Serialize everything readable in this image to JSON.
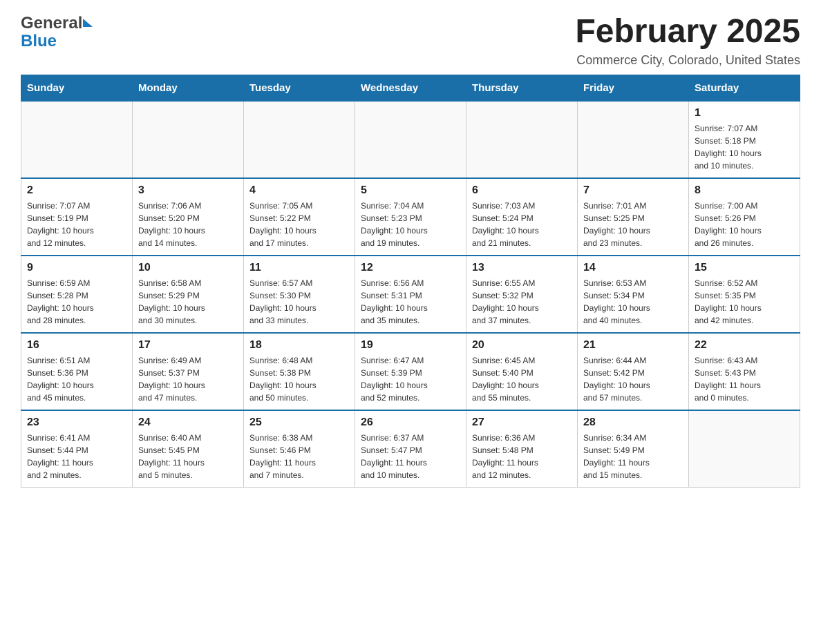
{
  "logo": {
    "general": "General",
    "blue": "Blue",
    "arrow_color": "#1a7abf"
  },
  "title": {
    "month_year": "February 2025",
    "location": "Commerce City, Colorado, United States"
  },
  "header_color": "#1a6fa8",
  "days_of_week": [
    "Sunday",
    "Monday",
    "Tuesday",
    "Wednesday",
    "Thursday",
    "Friday",
    "Saturday"
  ],
  "weeks": [
    {
      "days": [
        {
          "number": "",
          "info": ""
        },
        {
          "number": "",
          "info": ""
        },
        {
          "number": "",
          "info": ""
        },
        {
          "number": "",
          "info": ""
        },
        {
          "number": "",
          "info": ""
        },
        {
          "number": "",
          "info": ""
        },
        {
          "number": "1",
          "info": "Sunrise: 7:07 AM\nSunset: 5:18 PM\nDaylight: 10 hours\nand 10 minutes."
        }
      ]
    },
    {
      "days": [
        {
          "number": "2",
          "info": "Sunrise: 7:07 AM\nSunset: 5:19 PM\nDaylight: 10 hours\nand 12 minutes."
        },
        {
          "number": "3",
          "info": "Sunrise: 7:06 AM\nSunset: 5:20 PM\nDaylight: 10 hours\nand 14 minutes."
        },
        {
          "number": "4",
          "info": "Sunrise: 7:05 AM\nSunset: 5:22 PM\nDaylight: 10 hours\nand 17 minutes."
        },
        {
          "number": "5",
          "info": "Sunrise: 7:04 AM\nSunset: 5:23 PM\nDaylight: 10 hours\nand 19 minutes."
        },
        {
          "number": "6",
          "info": "Sunrise: 7:03 AM\nSunset: 5:24 PM\nDaylight: 10 hours\nand 21 minutes."
        },
        {
          "number": "7",
          "info": "Sunrise: 7:01 AM\nSunset: 5:25 PM\nDaylight: 10 hours\nand 23 minutes."
        },
        {
          "number": "8",
          "info": "Sunrise: 7:00 AM\nSunset: 5:26 PM\nDaylight: 10 hours\nand 26 minutes."
        }
      ]
    },
    {
      "days": [
        {
          "number": "9",
          "info": "Sunrise: 6:59 AM\nSunset: 5:28 PM\nDaylight: 10 hours\nand 28 minutes."
        },
        {
          "number": "10",
          "info": "Sunrise: 6:58 AM\nSunset: 5:29 PM\nDaylight: 10 hours\nand 30 minutes."
        },
        {
          "number": "11",
          "info": "Sunrise: 6:57 AM\nSunset: 5:30 PM\nDaylight: 10 hours\nand 33 minutes."
        },
        {
          "number": "12",
          "info": "Sunrise: 6:56 AM\nSunset: 5:31 PM\nDaylight: 10 hours\nand 35 minutes."
        },
        {
          "number": "13",
          "info": "Sunrise: 6:55 AM\nSunset: 5:32 PM\nDaylight: 10 hours\nand 37 minutes."
        },
        {
          "number": "14",
          "info": "Sunrise: 6:53 AM\nSunset: 5:34 PM\nDaylight: 10 hours\nand 40 minutes."
        },
        {
          "number": "15",
          "info": "Sunrise: 6:52 AM\nSunset: 5:35 PM\nDaylight: 10 hours\nand 42 minutes."
        }
      ]
    },
    {
      "days": [
        {
          "number": "16",
          "info": "Sunrise: 6:51 AM\nSunset: 5:36 PM\nDaylight: 10 hours\nand 45 minutes."
        },
        {
          "number": "17",
          "info": "Sunrise: 6:49 AM\nSunset: 5:37 PM\nDaylight: 10 hours\nand 47 minutes."
        },
        {
          "number": "18",
          "info": "Sunrise: 6:48 AM\nSunset: 5:38 PM\nDaylight: 10 hours\nand 50 minutes."
        },
        {
          "number": "19",
          "info": "Sunrise: 6:47 AM\nSunset: 5:39 PM\nDaylight: 10 hours\nand 52 minutes."
        },
        {
          "number": "20",
          "info": "Sunrise: 6:45 AM\nSunset: 5:40 PM\nDaylight: 10 hours\nand 55 minutes."
        },
        {
          "number": "21",
          "info": "Sunrise: 6:44 AM\nSunset: 5:42 PM\nDaylight: 10 hours\nand 57 minutes."
        },
        {
          "number": "22",
          "info": "Sunrise: 6:43 AM\nSunset: 5:43 PM\nDaylight: 11 hours\nand 0 minutes."
        }
      ]
    },
    {
      "days": [
        {
          "number": "23",
          "info": "Sunrise: 6:41 AM\nSunset: 5:44 PM\nDaylight: 11 hours\nand 2 minutes."
        },
        {
          "number": "24",
          "info": "Sunrise: 6:40 AM\nSunset: 5:45 PM\nDaylight: 11 hours\nand 5 minutes."
        },
        {
          "number": "25",
          "info": "Sunrise: 6:38 AM\nSunset: 5:46 PM\nDaylight: 11 hours\nand 7 minutes."
        },
        {
          "number": "26",
          "info": "Sunrise: 6:37 AM\nSunset: 5:47 PM\nDaylight: 11 hours\nand 10 minutes."
        },
        {
          "number": "27",
          "info": "Sunrise: 6:36 AM\nSunset: 5:48 PM\nDaylight: 11 hours\nand 12 minutes."
        },
        {
          "number": "28",
          "info": "Sunrise: 6:34 AM\nSunset: 5:49 PM\nDaylight: 11 hours\nand 15 minutes."
        },
        {
          "number": "",
          "info": ""
        }
      ]
    }
  ]
}
